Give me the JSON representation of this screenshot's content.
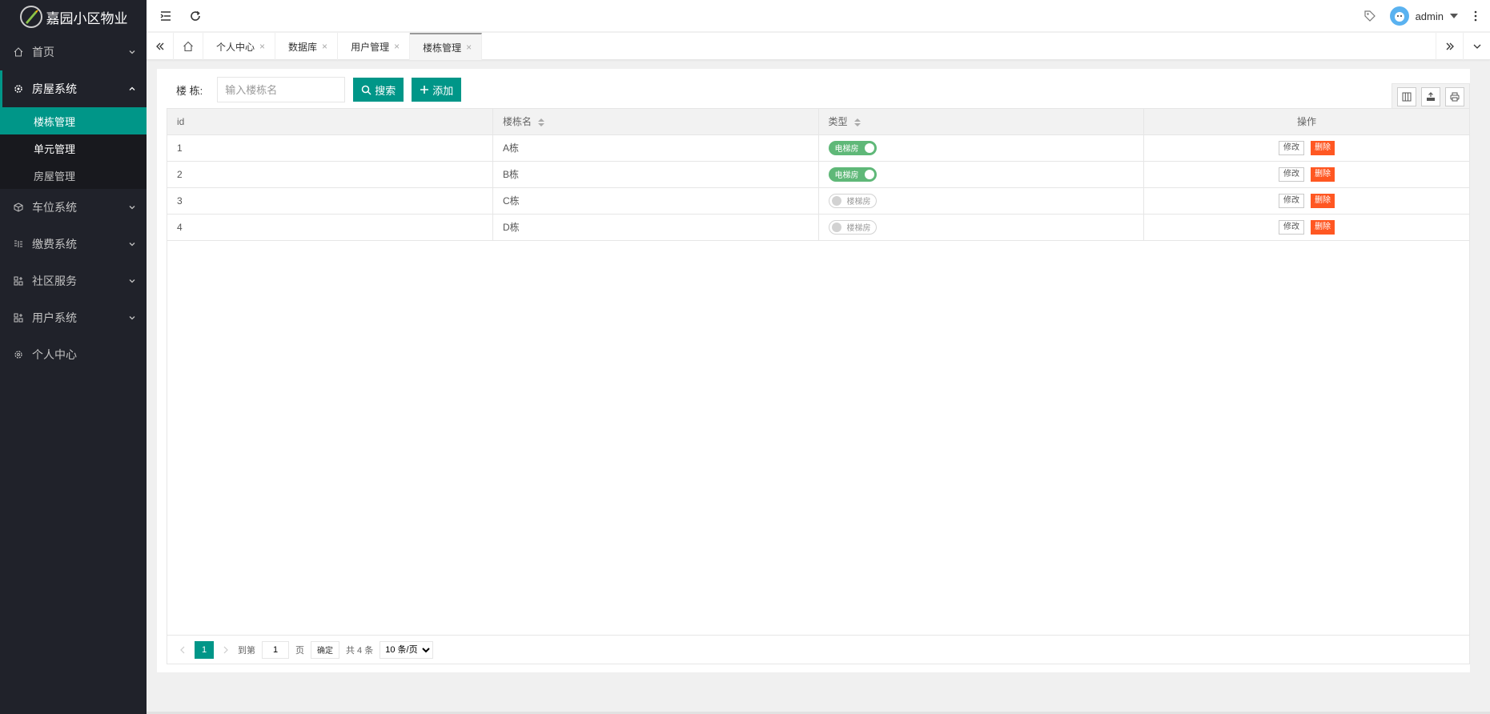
{
  "app": {
    "title": "嘉园小区物业",
    "user": "admin",
    "colors": {
      "accent": "#009688",
      "sidebar": "#20222a",
      "danger": "#ff5722",
      "switch_on": "#5fb878"
    }
  },
  "sidebar": {
    "items": [
      {
        "label": "首页",
        "icon": "home-icon"
      },
      {
        "label": "房屋系统",
        "icon": "gear-icon",
        "open": true,
        "children": [
          {
            "label": "楼栋管理",
            "active": true
          },
          {
            "label": "单元管理"
          },
          {
            "label": "房屋管理"
          }
        ]
      },
      {
        "label": "车位系统",
        "icon": "cube-icon"
      },
      {
        "label": "缴费系统",
        "icon": "list-icon"
      },
      {
        "label": "社区服务",
        "icon": "apps-icon"
      },
      {
        "label": "用户系统",
        "icon": "apps-icon"
      },
      {
        "label": "个人中心",
        "icon": "settings-icon"
      }
    ]
  },
  "tabs": [
    {
      "label": "个人中心"
    },
    {
      "label": "数据库"
    },
    {
      "label": "用户管理"
    },
    {
      "label": "楼栋管理",
      "active": true
    }
  ],
  "search": {
    "label": "楼 栋:",
    "placeholder": "输入楼栋名",
    "search_btn": "搜索",
    "add_btn": "添加"
  },
  "table": {
    "headers": [
      "id",
      "楼栋名",
      "类型",
      "操作"
    ],
    "rows": [
      {
        "id": "1",
        "name": "A栋",
        "type": "电梯房",
        "elevator": true
      },
      {
        "id": "2",
        "name": "B栋",
        "type": "电梯房",
        "elevator": true
      },
      {
        "id": "3",
        "name": "C栋",
        "type": "楼梯房",
        "elevator": false
      },
      {
        "id": "4",
        "name": "D栋",
        "type": "楼梯房",
        "elevator": false
      }
    ],
    "edit_label": "修改",
    "delete_label": "删除"
  },
  "pager": {
    "current": "1",
    "goto_label": "到第",
    "page_value": "1",
    "page_unit": "页",
    "confirm": "确定",
    "total": "共 4 条",
    "page_size": "10 条/页"
  }
}
